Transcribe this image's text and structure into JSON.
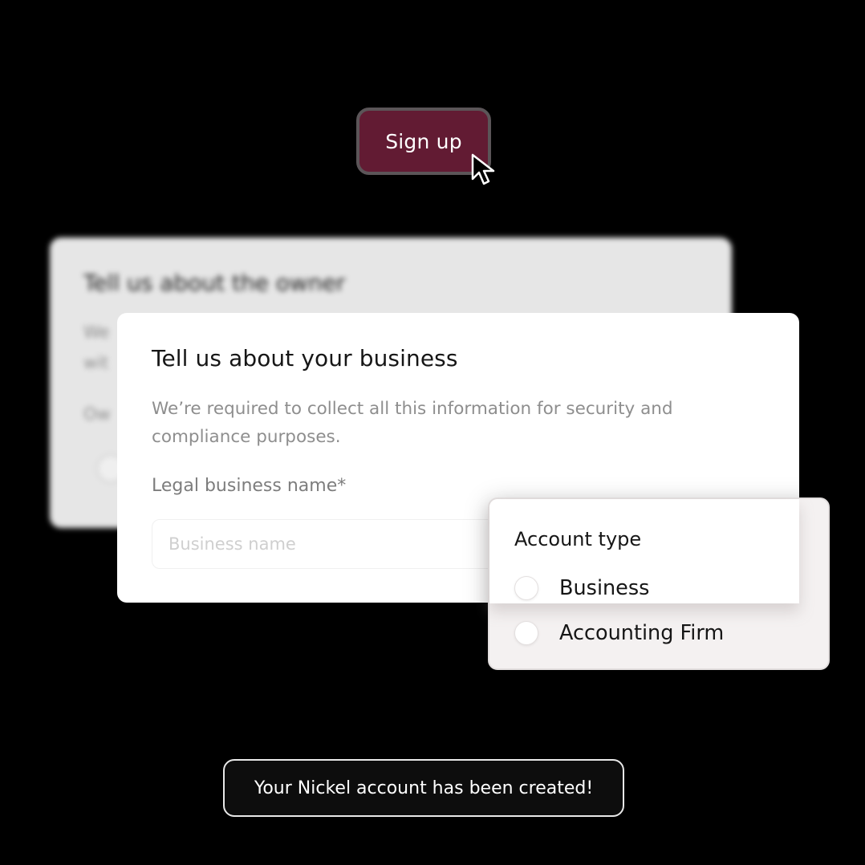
{
  "signup": {
    "label": "Sign up",
    "color": "#621b33",
    "border_color": "#5b5558"
  },
  "back_card": {
    "title": "Tell us about the owner",
    "line1": "We",
    "line2": "wit",
    "line3": "Ow"
  },
  "business_card": {
    "title": "Tell us about your business",
    "description": "We’re required to collect all this information for security and compliance purposes.",
    "field_label": "Legal business name*",
    "field_placeholder": "Business name",
    "field_value": ""
  },
  "account_type": {
    "title": "Account type",
    "options": [
      {
        "label": "Business",
        "selected": false
      },
      {
        "label": "Accounting Firm",
        "selected": false
      }
    ]
  },
  "toast": {
    "message": "Your Nickel account has been created!"
  },
  "icons": {
    "cursor": "arrow-pointer-icon"
  }
}
